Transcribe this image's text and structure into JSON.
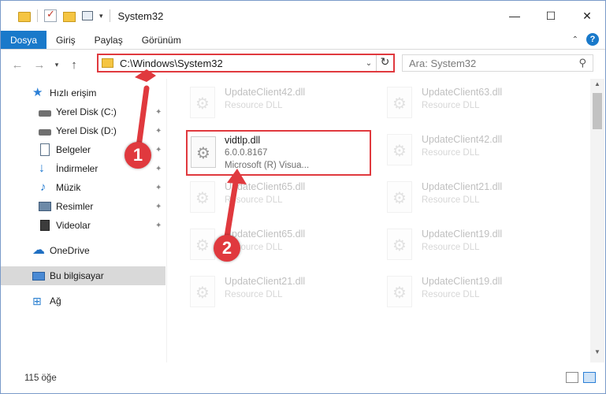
{
  "window": {
    "title": "System32",
    "controls": {
      "minimize": "—",
      "maximize": "☐",
      "close": "✕"
    }
  },
  "quick_access_toolbar": {
    "dropdown": "▾"
  },
  "ribbon": {
    "file_tab": "Dosya",
    "tabs": [
      "Giriş",
      "Paylaş",
      "Görünüm"
    ],
    "collapse": "⌃",
    "help": "?"
  },
  "navbar": {
    "back": "←",
    "forward": "→",
    "recent": "▾",
    "up": "↑",
    "address": "C:\\Windows\\System32",
    "address_dropdown": "⌄",
    "refresh": "↻",
    "search_placeholder": "Ara: System32",
    "search_icon": "⚲"
  },
  "nav_pane": {
    "items": [
      {
        "label": "Hızlı erişim",
        "icon": "star-icon",
        "pinned": false
      },
      {
        "label": "Yerel Disk (C:)",
        "icon": "disk-icon",
        "pinned": true
      },
      {
        "label": "Yerel Disk (D:)",
        "icon": "disk-icon",
        "pinned": true
      },
      {
        "label": "Belgeler",
        "icon": "document-icon",
        "pinned": true
      },
      {
        "label": "İndirmeler",
        "icon": "download-icon",
        "pinned": true
      },
      {
        "label": "Müzik",
        "icon": "music-icon",
        "pinned": true
      },
      {
        "label": "Resimler",
        "icon": "pictures-icon",
        "pinned": true
      },
      {
        "label": "Videolar",
        "icon": "videos-icon",
        "pinned": true
      },
      {
        "label": "OneDrive",
        "icon": "cloud-icon",
        "pinned": false
      },
      {
        "label": "Bu bilgisayar",
        "icon": "computer-icon",
        "pinned": false,
        "selected": true
      },
      {
        "label": "Ağ",
        "icon": "network-icon",
        "pinned": false
      }
    ],
    "pin_glyph": "📌"
  },
  "files": {
    "left_column": [
      {
        "name": "UpdateClient42.dll",
        "type": "Resource DLL"
      },
      {
        "name": "UpdateClient65.dll",
        "type": "Resource DLL"
      },
      {
        "name": "UpdateClient65.dll",
        "type": "Resource DLL"
      },
      {
        "name": "UpdateClient21.dll",
        "type": "Resource DLL"
      }
    ],
    "right_column": [
      {
        "name": "UpdateClient63.dll",
        "type": "Resource DLL"
      },
      {
        "name": "UpdateClient42.dll",
        "type": "Resource DLL"
      },
      {
        "name": "UpdateClient21.dll",
        "type": "Resource DLL"
      },
      {
        "name": "UpdateClient19.dll",
        "type": "Resource DLL"
      },
      {
        "name": "UpdateClient19.dll",
        "type": "Resource DLL"
      }
    ],
    "highlighted": {
      "name": "vidtlp.dll",
      "version": "6.0.0.8167",
      "description": "Microsoft (R) Visua..."
    }
  },
  "status_bar": {
    "item_count": "115 öğe"
  },
  "annotations": {
    "step1": "1",
    "step2": "2",
    "color": "#e0393e"
  }
}
